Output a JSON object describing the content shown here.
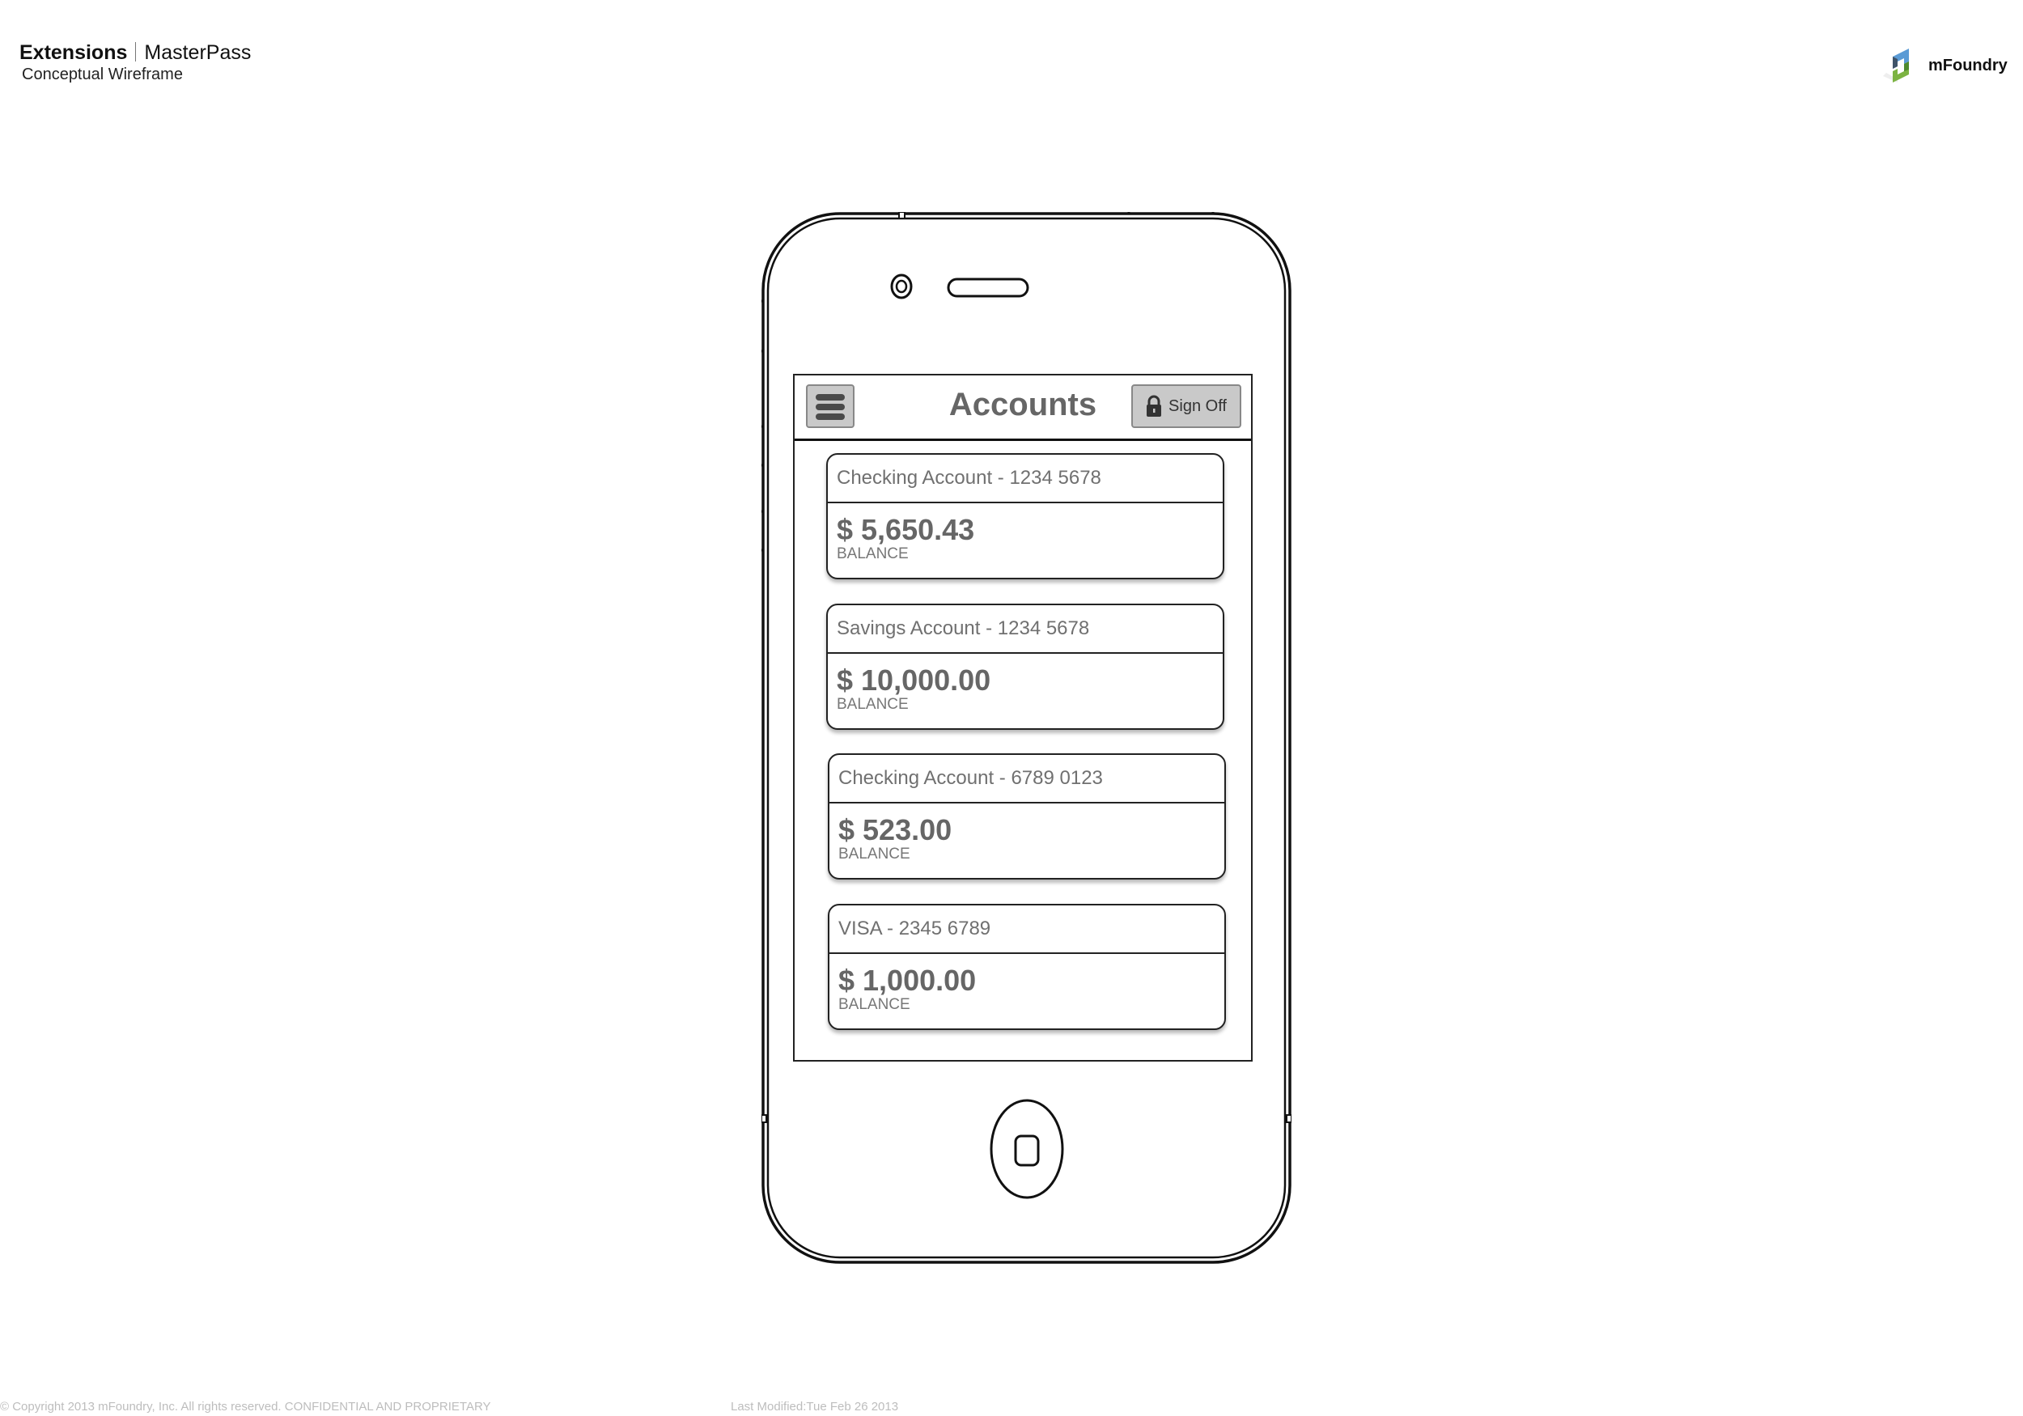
{
  "document": {
    "title_bold": "Extensions",
    "title_product": "MasterPass",
    "subtitle": "Conceptual Wireframe",
    "brand_name": "mFoundry",
    "brand_colors": {
      "blue": "#5b9bd5",
      "green": "#7cb342",
      "dark": "#3f5368"
    }
  },
  "app": {
    "nav": {
      "menu_icon": "hamburger-menu-icon",
      "title": "Accounts",
      "signoff_icon": "lock-icon",
      "signoff_label": "Sign Off"
    },
    "accounts": [
      {
        "name": "Checking Account - 1234 5678",
        "amount": "$ 5,650.43",
        "balance_label": "BALANCE"
      },
      {
        "name": "Savings Account - 1234 5678",
        "amount": "$ 10,000.00",
        "balance_label": "BALANCE"
      },
      {
        "name": "Checking Account - 6789 0123",
        "amount": "$ 523.00",
        "balance_label": "BALANCE"
      },
      {
        "name": "VISA - 2345 6789",
        "amount": "$ 1,000.00",
        "balance_label": "BALANCE"
      }
    ]
  },
  "footer": {
    "copyright": "© Copyright 2013 mFoundry, Inc. All rights reserved. CONFIDENTIAL AND PROPRIETARY",
    "last_modified": "Last Modified:Tue Feb 26 2013"
  }
}
